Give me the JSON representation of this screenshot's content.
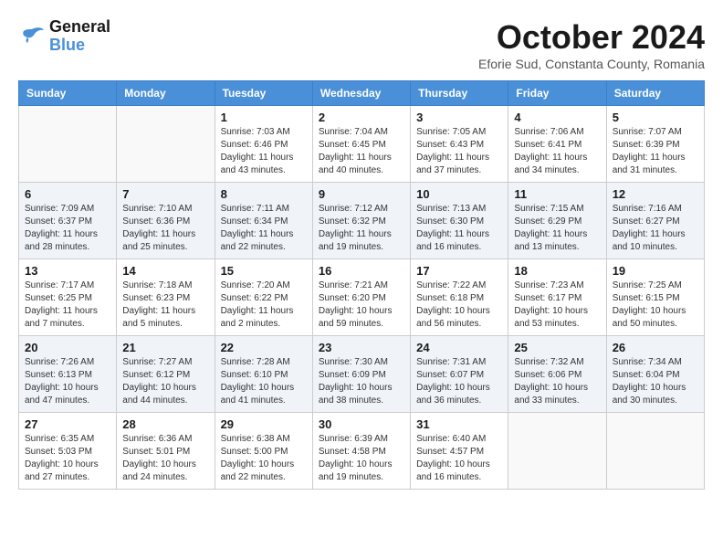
{
  "logo": {
    "line1": "General",
    "line2": "Blue"
  },
  "header": {
    "title": "October 2024",
    "location": "Eforie Sud, Constanta County, Romania"
  },
  "weekdays": [
    "Sunday",
    "Monday",
    "Tuesday",
    "Wednesday",
    "Thursday",
    "Friday",
    "Saturday"
  ],
  "weeks": [
    [
      {
        "day": "",
        "info": ""
      },
      {
        "day": "",
        "info": ""
      },
      {
        "day": "1",
        "info": "Sunrise: 7:03 AM\nSunset: 6:46 PM\nDaylight: 11 hours and 43 minutes."
      },
      {
        "day": "2",
        "info": "Sunrise: 7:04 AM\nSunset: 6:45 PM\nDaylight: 11 hours and 40 minutes."
      },
      {
        "day": "3",
        "info": "Sunrise: 7:05 AM\nSunset: 6:43 PM\nDaylight: 11 hours and 37 minutes."
      },
      {
        "day": "4",
        "info": "Sunrise: 7:06 AM\nSunset: 6:41 PM\nDaylight: 11 hours and 34 minutes."
      },
      {
        "day": "5",
        "info": "Sunrise: 7:07 AM\nSunset: 6:39 PM\nDaylight: 11 hours and 31 minutes."
      }
    ],
    [
      {
        "day": "6",
        "info": "Sunrise: 7:09 AM\nSunset: 6:37 PM\nDaylight: 11 hours and 28 minutes."
      },
      {
        "day": "7",
        "info": "Sunrise: 7:10 AM\nSunset: 6:36 PM\nDaylight: 11 hours and 25 minutes."
      },
      {
        "day": "8",
        "info": "Sunrise: 7:11 AM\nSunset: 6:34 PM\nDaylight: 11 hours and 22 minutes."
      },
      {
        "day": "9",
        "info": "Sunrise: 7:12 AM\nSunset: 6:32 PM\nDaylight: 11 hours and 19 minutes."
      },
      {
        "day": "10",
        "info": "Sunrise: 7:13 AM\nSunset: 6:30 PM\nDaylight: 11 hours and 16 minutes."
      },
      {
        "day": "11",
        "info": "Sunrise: 7:15 AM\nSunset: 6:29 PM\nDaylight: 11 hours and 13 minutes."
      },
      {
        "day": "12",
        "info": "Sunrise: 7:16 AM\nSunset: 6:27 PM\nDaylight: 11 hours and 10 minutes."
      }
    ],
    [
      {
        "day": "13",
        "info": "Sunrise: 7:17 AM\nSunset: 6:25 PM\nDaylight: 11 hours and 7 minutes."
      },
      {
        "day": "14",
        "info": "Sunrise: 7:18 AM\nSunset: 6:23 PM\nDaylight: 11 hours and 5 minutes."
      },
      {
        "day": "15",
        "info": "Sunrise: 7:20 AM\nSunset: 6:22 PM\nDaylight: 11 hours and 2 minutes."
      },
      {
        "day": "16",
        "info": "Sunrise: 7:21 AM\nSunset: 6:20 PM\nDaylight: 10 hours and 59 minutes."
      },
      {
        "day": "17",
        "info": "Sunrise: 7:22 AM\nSunset: 6:18 PM\nDaylight: 10 hours and 56 minutes."
      },
      {
        "day": "18",
        "info": "Sunrise: 7:23 AM\nSunset: 6:17 PM\nDaylight: 10 hours and 53 minutes."
      },
      {
        "day": "19",
        "info": "Sunrise: 7:25 AM\nSunset: 6:15 PM\nDaylight: 10 hours and 50 minutes."
      }
    ],
    [
      {
        "day": "20",
        "info": "Sunrise: 7:26 AM\nSunset: 6:13 PM\nDaylight: 10 hours and 47 minutes."
      },
      {
        "day": "21",
        "info": "Sunrise: 7:27 AM\nSunset: 6:12 PM\nDaylight: 10 hours and 44 minutes."
      },
      {
        "day": "22",
        "info": "Sunrise: 7:28 AM\nSunset: 6:10 PM\nDaylight: 10 hours and 41 minutes."
      },
      {
        "day": "23",
        "info": "Sunrise: 7:30 AM\nSunset: 6:09 PM\nDaylight: 10 hours and 38 minutes."
      },
      {
        "day": "24",
        "info": "Sunrise: 7:31 AM\nSunset: 6:07 PM\nDaylight: 10 hours and 36 minutes."
      },
      {
        "day": "25",
        "info": "Sunrise: 7:32 AM\nSunset: 6:06 PM\nDaylight: 10 hours and 33 minutes."
      },
      {
        "day": "26",
        "info": "Sunrise: 7:34 AM\nSunset: 6:04 PM\nDaylight: 10 hours and 30 minutes."
      }
    ],
    [
      {
        "day": "27",
        "info": "Sunrise: 6:35 AM\nSunset: 5:03 PM\nDaylight: 10 hours and 27 minutes."
      },
      {
        "day": "28",
        "info": "Sunrise: 6:36 AM\nSunset: 5:01 PM\nDaylight: 10 hours and 24 minutes."
      },
      {
        "day": "29",
        "info": "Sunrise: 6:38 AM\nSunset: 5:00 PM\nDaylight: 10 hours and 22 minutes."
      },
      {
        "day": "30",
        "info": "Sunrise: 6:39 AM\nSunset: 4:58 PM\nDaylight: 10 hours and 19 minutes."
      },
      {
        "day": "31",
        "info": "Sunrise: 6:40 AM\nSunset: 4:57 PM\nDaylight: 10 hours and 16 minutes."
      },
      {
        "day": "",
        "info": ""
      },
      {
        "day": "",
        "info": ""
      }
    ]
  ]
}
